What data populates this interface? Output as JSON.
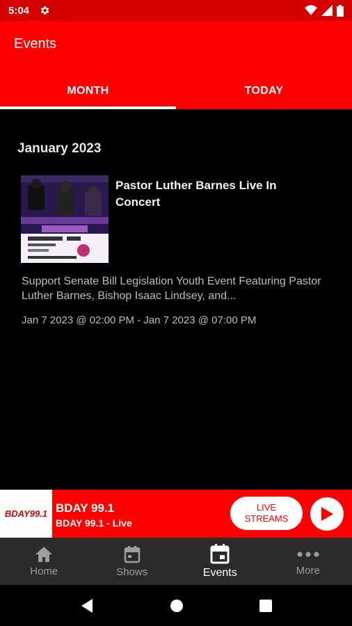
{
  "status_bar": {
    "time": "5:04",
    "icons": [
      "gear-icon",
      "wifi-icon",
      "signal-icon",
      "battery-icon"
    ]
  },
  "app_bar": {
    "title": "Events"
  },
  "tabs": [
    {
      "label": "MONTH",
      "active": true
    },
    {
      "label": "TODAY",
      "active": false
    }
  ],
  "events_section": {
    "month": "January 2023",
    "event": {
      "title": "Pastor Luther Barnes Live In Concert",
      "description": "Support Senate Bill Legislation Youth Event Featuring Pastor Luther Barnes, Bishop Isaac Lindsey, and...",
      "date_range": "Jan 7 2023 @ 02:00 PM - Jan 7 2023 @ 07:00 PM"
    }
  },
  "player": {
    "logo_text": "BDAY99.1",
    "station": "BDAY 99.1",
    "subtitle": "BDAY 99.1 - Live",
    "live_line1": "LIVE",
    "live_line2": "STREAMS"
  },
  "bottom_nav": [
    {
      "label": "Home",
      "icon": "home-icon",
      "active": false
    },
    {
      "label": "Shows",
      "icon": "calendar-icon",
      "active": false
    },
    {
      "label": "Events",
      "icon": "event-icon",
      "active": true
    },
    {
      "label": "More",
      "icon": "more-icon",
      "active": false
    }
  ],
  "colors": {
    "brand_red": "#ff0000",
    "status_red": "#d40000",
    "nav_bg": "#2b2b2b"
  }
}
